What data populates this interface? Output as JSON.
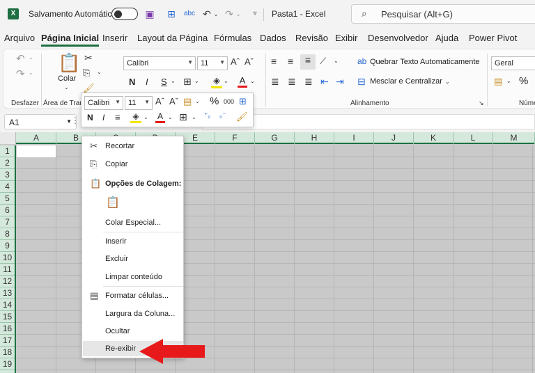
{
  "titlebar": {
    "logo": "X",
    "autosave_label": "Salvamento Automático",
    "doc_title": "Pasta1  -  Excel",
    "search_placeholder": "Pesquisar (Alt+G)",
    "spell_label": "abc"
  },
  "tabs": [
    {
      "label": "Arquivo"
    },
    {
      "label": "Página Inicial"
    },
    {
      "label": "Inserir"
    },
    {
      "label": "Layout da Página"
    },
    {
      "label": "Fórmulas"
    },
    {
      "label": "Dados"
    },
    {
      "label": "Revisão"
    },
    {
      "label": "Exibir"
    },
    {
      "label": "Desenvolvedor"
    },
    {
      "label": "Ajuda"
    },
    {
      "label": "Power Pivot"
    }
  ],
  "ribbon": {
    "undo_group": "Desfazer",
    "clipboard_group": "Área de Trans",
    "paste_label": "Colar",
    "font_name": "Calibri",
    "font_size": "11",
    "bold": "N",
    "italic": "I",
    "underline": "S",
    "font_color_letter": "A",
    "wrap_text": "Quebrar Texto Automaticamente",
    "merge_center": "Mesclar e Centralizar",
    "alignment_group": "Alinhamento",
    "number_format": "Geral",
    "percent": "%",
    "number_group": "Núme"
  },
  "mini_toolbar": {
    "font_name": "Calibri",
    "font_size": "11",
    "percent": "%",
    "thousands": "000",
    "bold": "N",
    "italic": "I",
    "font_color_letter": "A"
  },
  "namebox": {
    "value": "A1",
    "dots": "⋮"
  },
  "columns": [
    "A",
    "B",
    "C",
    "D",
    "E",
    "F",
    "G",
    "H",
    "I",
    "J",
    "K",
    "L",
    "M"
  ],
  "rows": [
    "1",
    "2",
    "3",
    "4",
    "5",
    "6",
    "7",
    "8",
    "9",
    "10",
    "11",
    "12",
    "13",
    "14",
    "15",
    "16",
    "17",
    "18",
    "19"
  ],
  "context_menu": {
    "cut": "Recortar",
    "copy": "Copiar",
    "paste_options": "Opções de Colagem:",
    "paste_special": "Colar Especial...",
    "insert": "Inserir",
    "delete": "Excluir",
    "clear_contents": "Limpar conteúdo",
    "format_cells": "Formatar células...",
    "column_width": "Largura da Coluna...",
    "hide": "Ocultar",
    "unhide": "Re-exibir"
  },
  "colors": {
    "excel_green": "#1d6f42",
    "arrow_red": "#e8191a",
    "grid_gray": "#c9c9c9"
  }
}
